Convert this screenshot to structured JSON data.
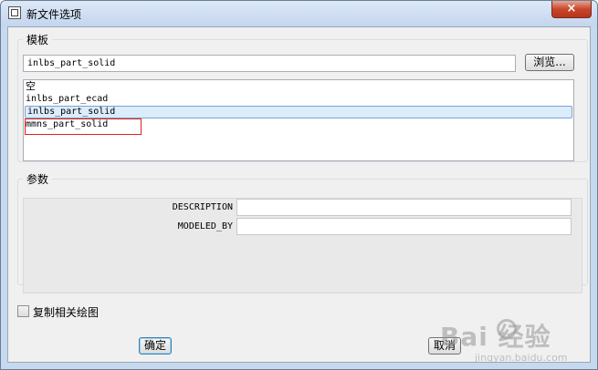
{
  "window": {
    "title": "新文件选项",
    "close_label": "×"
  },
  "template": {
    "legend": "模板",
    "input_value": "inlbs_part_solid",
    "browse_label": "浏览...",
    "items": [
      {
        "label": "空",
        "selected": false
      },
      {
        "label": "inlbs_part_ecad",
        "selected": false
      },
      {
        "label": "inlbs_part_solid",
        "selected": true
      },
      {
        "label": "mmns_part_solid",
        "selected": false,
        "highlighted_red": true
      }
    ]
  },
  "params": {
    "legend": "参数",
    "rows": [
      {
        "label": "DESCRIPTION",
        "value": ""
      },
      {
        "label": "MODELED_BY",
        "value": ""
      }
    ]
  },
  "options": {
    "copy_drawings_label": "复制相关绘图",
    "copy_drawings_checked": false
  },
  "buttons": {
    "ok": "确定",
    "cancel": "取消"
  },
  "watermark": {
    "brand": "Bai  经验",
    "url": "jingyan.baidu.com"
  },
  "colors": {
    "selection": "#dbecfb",
    "selection_border": "#7da2ce",
    "annotation_red": "#e02020",
    "close_red": "#c9462c"
  }
}
